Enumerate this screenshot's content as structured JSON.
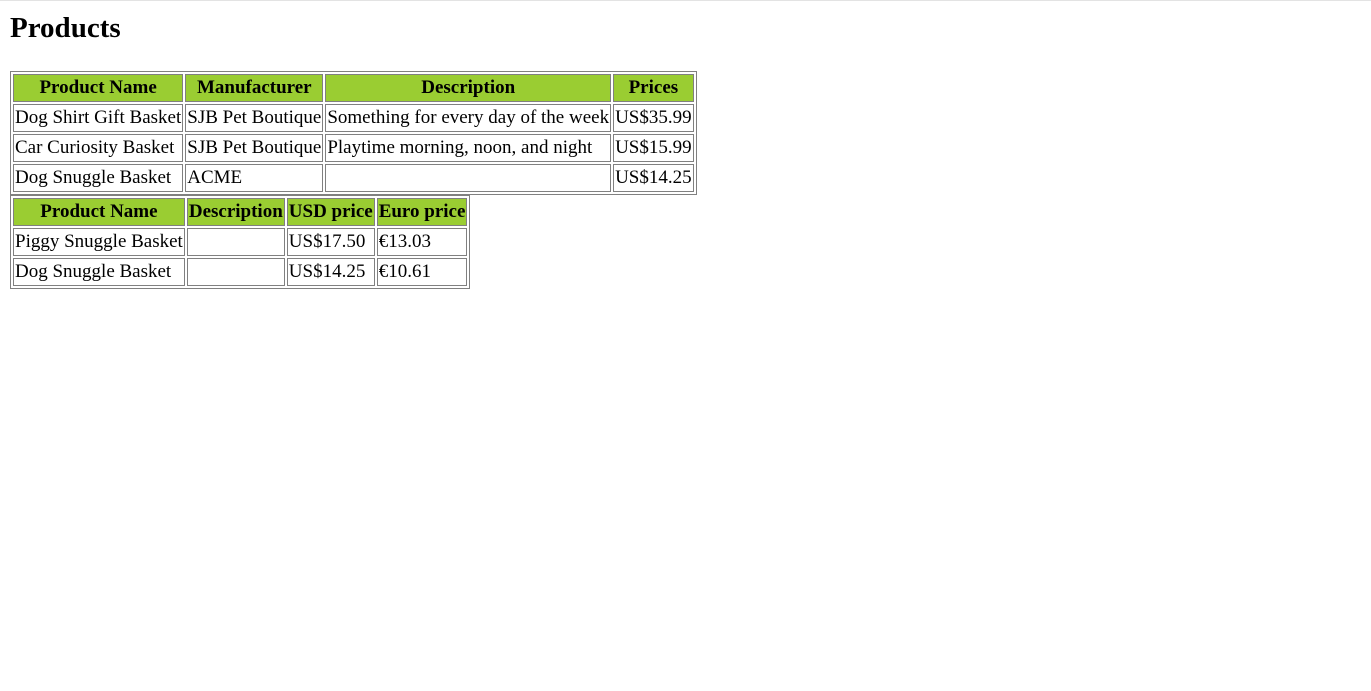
{
  "page": {
    "title": "Products"
  },
  "colors": {
    "header_bg": "#9acd32",
    "border": "#808080"
  },
  "table1": {
    "headers": [
      "Product Name",
      "Manufacturer",
      "Description",
      "Prices"
    ],
    "rows": [
      [
        "Dog Shirt Gift Basket",
        "SJB Pet Boutique",
        "Something for every day of the week",
        "US$35.99"
      ],
      [
        "Car Curiosity Basket",
        "SJB Pet Boutique",
        "Playtime morning, noon, and night",
        "US$15.99"
      ],
      [
        "Dog Snuggle Basket",
        "ACME",
        "",
        "US$14.25"
      ]
    ]
  },
  "table2": {
    "headers": [
      "Product Name",
      "Description",
      "USD price",
      "Euro price"
    ],
    "rows": [
      [
        "Piggy Snuggle Basket",
        "",
        "US$17.50",
        "€13.03"
      ],
      [
        "Dog Snuggle Basket",
        "",
        "US$14.25",
        "€10.61"
      ]
    ]
  }
}
